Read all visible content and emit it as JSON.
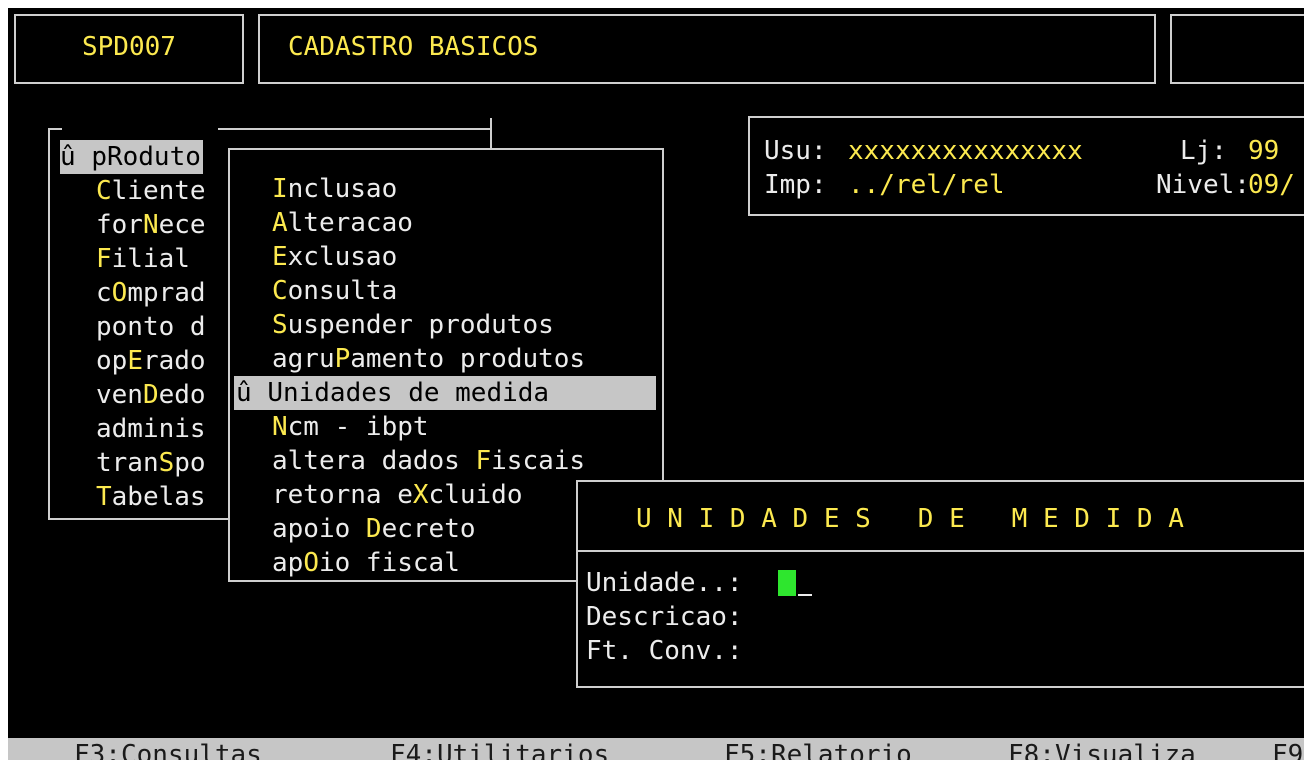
{
  "header": {
    "program_code": "SPD007",
    "program_title": "CADASTRO BASICOS"
  },
  "info": {
    "user_label": "Usu:",
    "user_value": "xxxxxxxxxxxxxxx",
    "store_label": "Lj:",
    "store_value": "99",
    "printer_label": "Imp:",
    "printer_value": "../rel/rel",
    "level_label": "Nivel:",
    "level_value": "09/"
  },
  "main_menu": {
    "marker": "û",
    "items": [
      {
        "pre": "p",
        "hot": "R",
        "post": "oduto"
      },
      {
        "pre": "",
        "hot": "C",
        "post": "liente"
      },
      {
        "pre": "for",
        "hot": "N",
        "post": "ece"
      },
      {
        "pre": "",
        "hot": "F",
        "post": "ilial"
      },
      {
        "pre": "c",
        "hot": "O",
        "post": "mprad"
      },
      {
        "pre": "ponto d",
        "hot": "",
        "post": ""
      },
      {
        "pre": "op",
        "hot": "E",
        "post": "rado"
      },
      {
        "pre": "ven",
        "hot": "D",
        "post": "edo"
      },
      {
        "pre": "adminis",
        "hot": "",
        "post": ""
      },
      {
        "pre": "tran",
        "hot": "S",
        "post": "po"
      },
      {
        "pre": "",
        "hot": "T",
        "post": "abelas"
      }
    ]
  },
  "sub_menu": {
    "marker": "û",
    "items": [
      {
        "pre": "",
        "hot": "I",
        "post": "nclusao"
      },
      {
        "pre": "",
        "hot": "A",
        "post": "lteracao"
      },
      {
        "pre": "",
        "hot": "E",
        "post": "xclusao"
      },
      {
        "pre": "",
        "hot": "C",
        "post": "onsulta"
      },
      {
        "pre": "",
        "hot": "S",
        "post": "uspender produtos"
      },
      {
        "pre": "agru",
        "hot": "P",
        "post": "amento produtos"
      },
      {
        "pre": "",
        "hot": "U",
        "post": "nidades de medida"
      },
      {
        "pre": "",
        "hot": "N",
        "post": "cm - ibpt"
      },
      {
        "pre": "altera dados ",
        "hot": "F",
        "post": "iscais"
      },
      {
        "pre": "retorna e",
        "hot": "X",
        "post": "cluido"
      },
      {
        "pre": "apoio ",
        "hot": "D",
        "post": "ecreto"
      },
      {
        "pre": "ap",
        "hot": "O",
        "post": "io fiscal"
      }
    ]
  },
  "dialog": {
    "title": "U N I D A D E S   D E   M E D I D A",
    "unit_label": "Unidade..:",
    "desc_label": "Descricao:",
    "conv_label": "Ft. Conv.:",
    "unit_value": "",
    "desc_value": "",
    "conv_value": ""
  },
  "function_keys": [
    {
      "label": "F3:Consultas"
    },
    {
      "label": "F4:Utilitarios"
    },
    {
      "label": "F5:Relatorio"
    },
    {
      "label": "F8:Visualiza"
    },
    {
      "label": "F9"
    }
  ],
  "colors": {
    "background": "#000000",
    "text": "#ececec",
    "hotkey": "#fce94f",
    "highlight": "#c6c6c6",
    "cursor": "#2ee62e"
  }
}
